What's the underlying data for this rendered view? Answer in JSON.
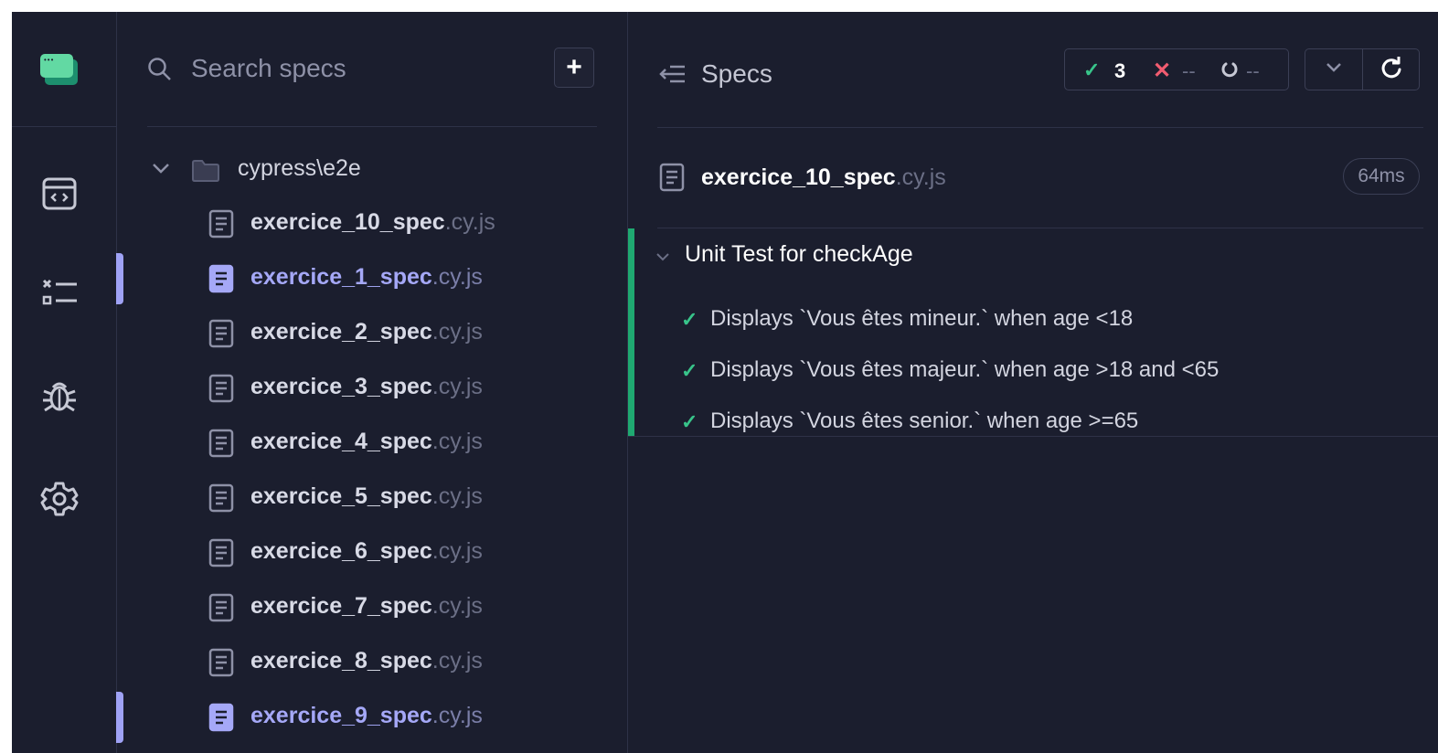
{
  "search": {
    "placeholder": "Search specs",
    "add_label": "+"
  },
  "folder": {
    "label": "cypress\\e2e"
  },
  "specs": [
    {
      "name": "exercice_10_spec",
      "ext": ".cy.js",
      "selected": false
    },
    {
      "name": "exercice_1_spec",
      "ext": ".cy.js",
      "selected": true
    },
    {
      "name": "exercice_2_spec",
      "ext": ".cy.js",
      "selected": false
    },
    {
      "name": "exercice_3_spec",
      "ext": ".cy.js",
      "selected": false
    },
    {
      "name": "exercice_4_spec",
      "ext": ".cy.js",
      "selected": false
    },
    {
      "name": "exercice_5_spec",
      "ext": ".cy.js",
      "selected": false
    },
    {
      "name": "exercice_6_spec",
      "ext": ".cy.js",
      "selected": false
    },
    {
      "name": "exercice_7_spec",
      "ext": ".cy.js",
      "selected": false
    },
    {
      "name": "exercice_8_spec",
      "ext": ".cy.js",
      "selected": false
    },
    {
      "name": "exercice_9_spec",
      "ext": ".cy.js",
      "selected": true
    }
  ],
  "reporter": {
    "specs_label": "Specs",
    "stats": {
      "passed": "3",
      "failed": "--",
      "pending": "--"
    },
    "file": {
      "name": "exercice_10_spec",
      "ext": ".cy.js",
      "duration": "64ms"
    },
    "suite": {
      "title": "Unit Test for checkAge",
      "tests": [
        "Displays `Vous êtes mineur.` when age <18",
        "Displays `Vous êtes majeur.` when age >18 and <65",
        "Displays `Vous êtes senior.` when age >=65"
      ]
    }
  },
  "nav": {
    "icons": [
      "runs-icon",
      "specs-icon",
      "debug-icon",
      "settings-icon"
    ]
  },
  "colors": {
    "background": "#1b1e2e",
    "accent": "#a5a8f7",
    "pass": "#38c48a",
    "fail": "#f15c70",
    "suite_bar": "#1fa971"
  }
}
